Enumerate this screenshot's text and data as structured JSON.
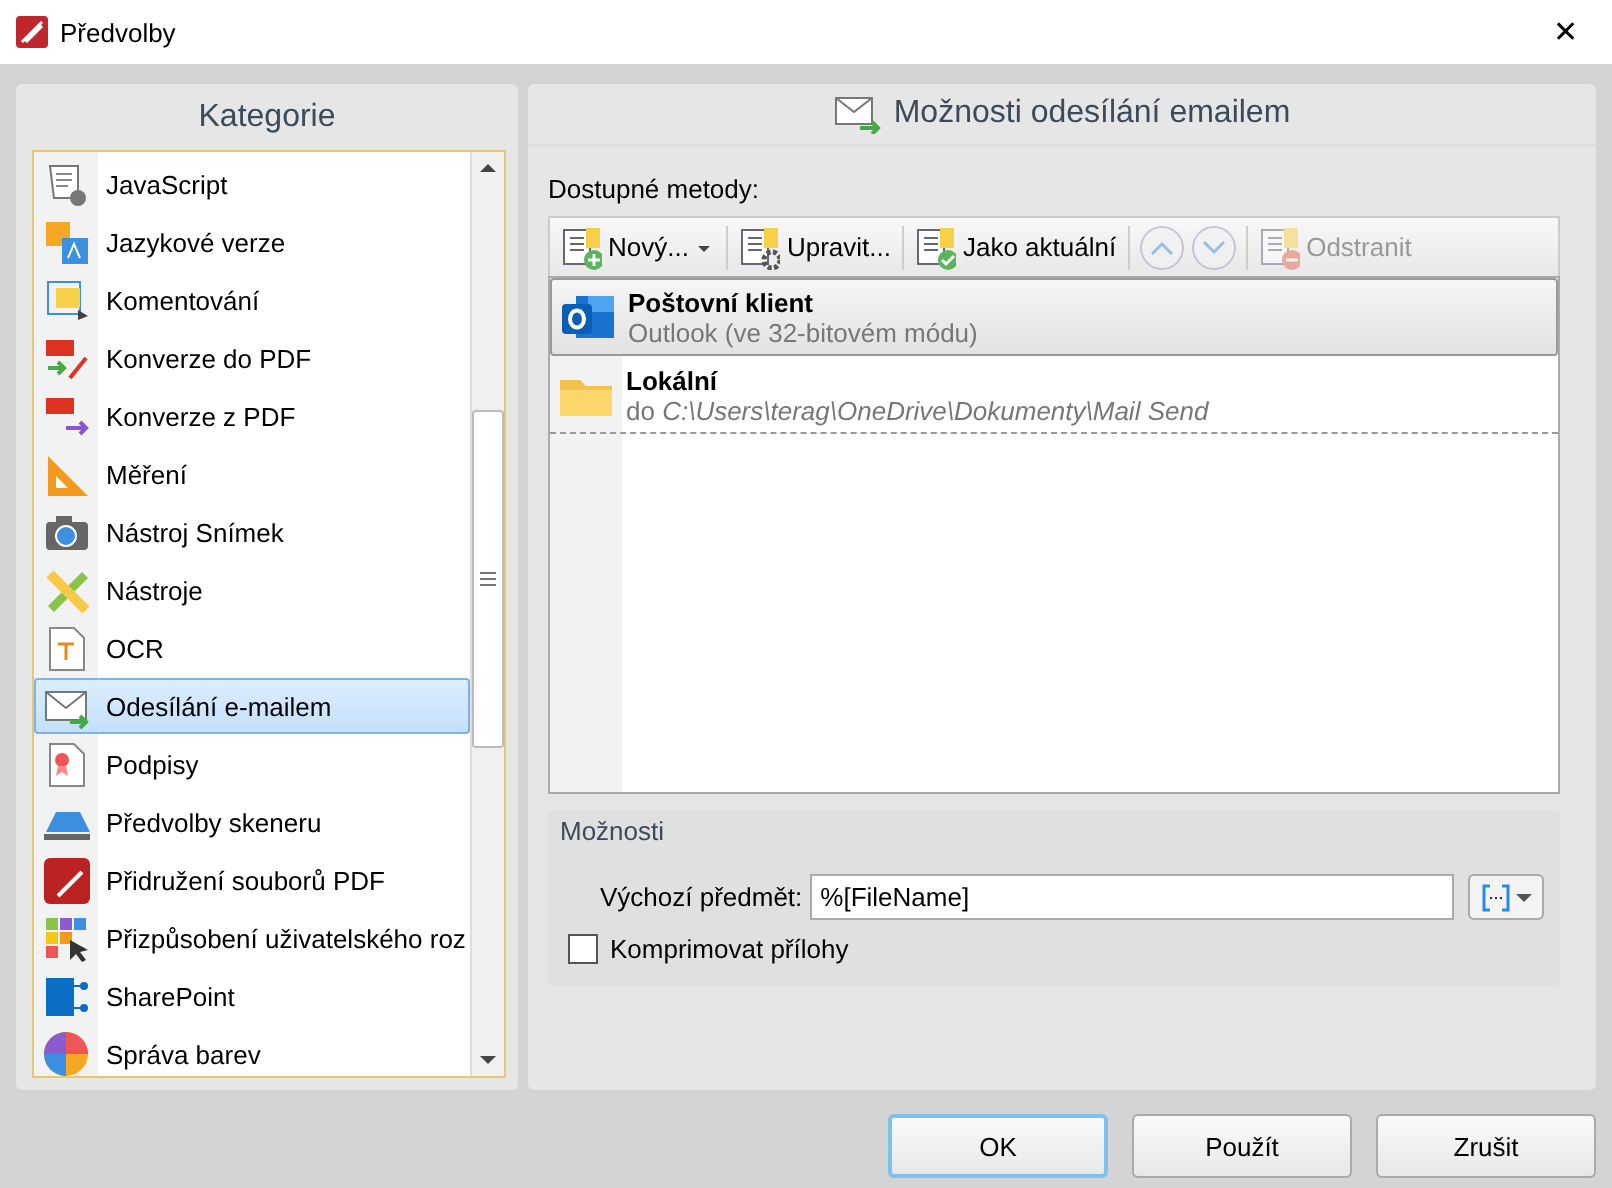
{
  "window": {
    "title": "Předvolby",
    "close": "✕"
  },
  "categories": {
    "title": "Kategorie",
    "items": [
      {
        "label": "JavaScript",
        "selected": false
      },
      {
        "label": "Jazykové verze",
        "selected": false
      },
      {
        "label": "Komentování",
        "selected": false
      },
      {
        "label": "Konverze do PDF",
        "selected": false
      },
      {
        "label": "Konverze z PDF",
        "selected": false
      },
      {
        "label": "Měření",
        "selected": false
      },
      {
        "label": "Nástroj Snímek",
        "selected": false
      },
      {
        "label": "Nástroje",
        "selected": false
      },
      {
        "label": "OCR",
        "selected": false
      },
      {
        "label": "Odesílání e-mailem",
        "selected": true
      },
      {
        "label": "Podpisy",
        "selected": false
      },
      {
        "label": "Předvolby skeneru",
        "selected": false
      },
      {
        "label": "Přidružení souborů PDF",
        "selected": false
      },
      {
        "label": "Přizpůsobení uživatelského roz",
        "selected": false
      },
      {
        "label": "SharePoint",
        "selected": false
      },
      {
        "label": "Správa barev",
        "selected": false
      }
    ]
  },
  "panel": {
    "title": "Možnosti odesílání emailem",
    "methods_label": "Dostupné metody:",
    "toolbar": [
      {
        "label": "Nový...",
        "kind": "split",
        "disabled": false
      },
      {
        "label": "Upravit...",
        "kind": "button",
        "disabled": false
      },
      {
        "label": "Jako aktuální",
        "kind": "button",
        "disabled": false
      },
      {
        "kind": "up",
        "disabled": true
      },
      {
        "kind": "down",
        "disabled": true
      },
      {
        "label": "Odstranit",
        "kind": "button",
        "disabled": true
      }
    ],
    "methods": [
      {
        "title": "Poštovní klient",
        "detail": "Outlook (ve 32-bitovém módu)",
        "kind": "mail-client",
        "selected": true
      },
      {
        "title": "Lokální",
        "detail_prefix": "do ",
        "detail": "C:\\Users\\terag\\OneDrive\\Dokumenty\\Mail Send",
        "kind": "local",
        "selected": false
      }
    ],
    "options": {
      "title": "Možnosti",
      "subject_label": "Výchozí předmět:",
      "subject_value": "%[FileName]",
      "compress": {
        "label": "Komprimovat přílohy",
        "checked": false
      }
    }
  },
  "buttons": [
    {
      "label": "OK",
      "default": true
    },
    {
      "label": "Použít",
      "default": false
    },
    {
      "label": "Zrušit",
      "default": false
    }
  ]
}
